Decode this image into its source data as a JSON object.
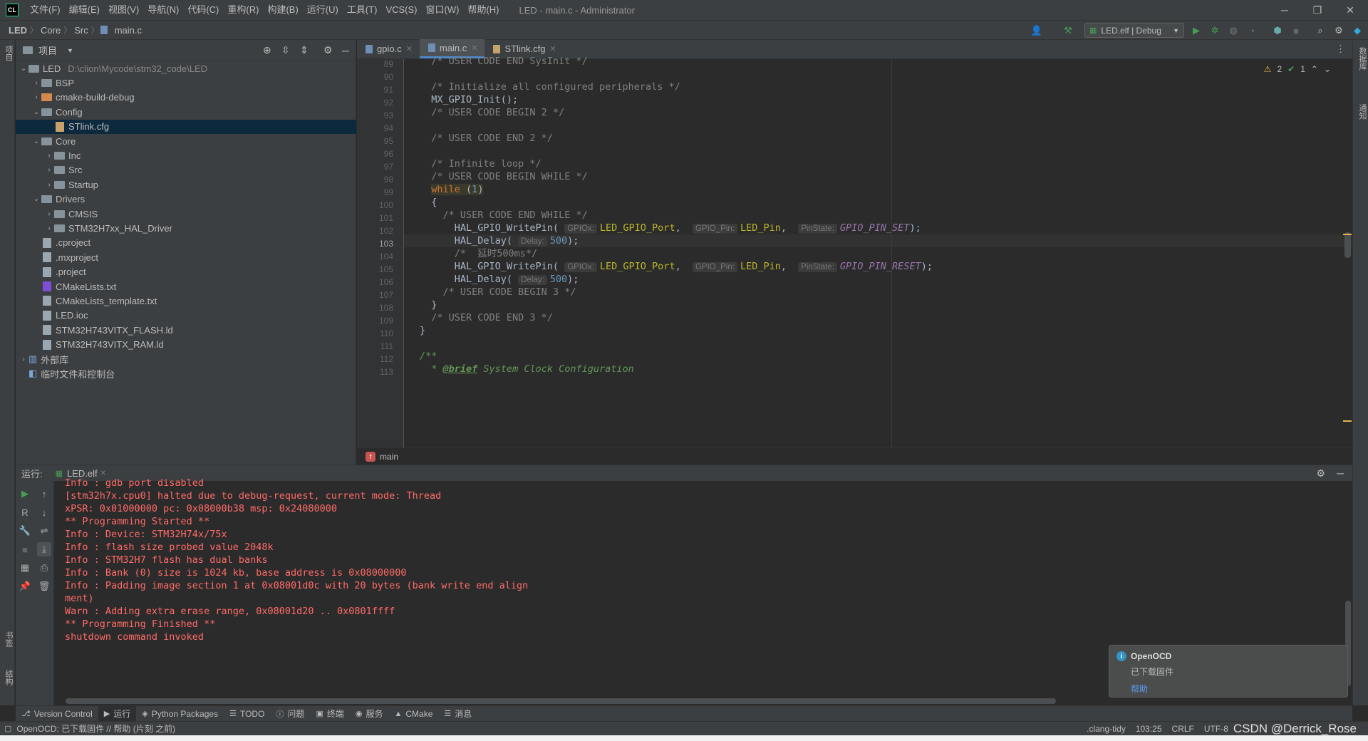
{
  "window": {
    "app_logo": "CL",
    "title": "LED - main.c - Administrator",
    "menu": [
      "文件(F)",
      "编辑(E)",
      "视图(V)",
      "导航(N)",
      "代码(C)",
      "重构(R)",
      "构建(B)",
      "运行(U)",
      "工具(T)",
      "VCS(S)",
      "窗口(W)",
      "帮助(H)"
    ],
    "controls": {
      "minimize": "─",
      "restore": "❐",
      "close": "✕"
    }
  },
  "navbar": {
    "crumbs": [
      "LED",
      "Core",
      "Src",
      "main.c"
    ],
    "run_config": "LED.elf | Debug"
  },
  "left_strip": {
    "labels": [
      "项目",
      "书签",
      "结构"
    ]
  },
  "right_strip": {
    "labels": [
      "数据库",
      "通知"
    ]
  },
  "project": {
    "title": "项目",
    "tree": [
      {
        "label": "LED",
        "hint": "D:\\clion\\Mycode\\stm32_code\\LED",
        "depth": 0,
        "expanded": true,
        "kind": "folder"
      },
      {
        "label": "BSP",
        "depth": 1,
        "expanded": false,
        "kind": "folder"
      },
      {
        "label": "cmake-build-debug",
        "depth": 1,
        "expanded": false,
        "kind": "folder-orange"
      },
      {
        "label": "Config",
        "depth": 1,
        "expanded": true,
        "kind": "folder"
      },
      {
        "label": "STlink.cfg",
        "depth": 2,
        "kind": "cfg",
        "selected": true
      },
      {
        "label": "Core",
        "depth": 1,
        "expanded": true,
        "kind": "folder"
      },
      {
        "label": "Inc",
        "depth": 2,
        "expanded": false,
        "kind": "folder"
      },
      {
        "label": "Src",
        "depth": 2,
        "expanded": false,
        "kind": "folder"
      },
      {
        "label": "Startup",
        "depth": 2,
        "expanded": false,
        "kind": "folder"
      },
      {
        "label": "Drivers",
        "depth": 1,
        "expanded": true,
        "kind": "folder"
      },
      {
        "label": "CMSIS",
        "depth": 2,
        "expanded": false,
        "kind": "folder"
      },
      {
        "label": "STM32H7xx_HAL_Driver",
        "depth": 2,
        "expanded": false,
        "kind": "folder"
      },
      {
        "label": ".cproject",
        "depth": 1,
        "kind": "file"
      },
      {
        "label": ".mxproject",
        "depth": 1,
        "kind": "file"
      },
      {
        "label": ".project",
        "depth": 1,
        "kind": "file"
      },
      {
        "label": "CMakeLists.txt",
        "depth": 1,
        "kind": "cmake"
      },
      {
        "label": "CMakeLists_template.txt",
        "depth": 1,
        "kind": "file"
      },
      {
        "label": "LED.ioc",
        "depth": 1,
        "kind": "file"
      },
      {
        "label": "STM32H743VITX_FLASH.ld",
        "depth": 1,
        "kind": "file"
      },
      {
        "label": "STM32H743VITX_RAM.ld",
        "depth": 1,
        "kind": "file"
      },
      {
        "label": "外部库",
        "depth": 0,
        "expanded": false,
        "kind": "lib"
      },
      {
        "label": "临时文件和控制台",
        "depth": 0,
        "kind": "scratch"
      }
    ]
  },
  "editor": {
    "tabs": [
      {
        "label": "gpio.c",
        "active": false
      },
      {
        "label": "main.c",
        "active": true
      },
      {
        "label": "STlink.cfg",
        "active": false
      }
    ],
    "inspections": {
      "warnings": "2",
      "ok": "1"
    },
    "current_line": "103",
    "lines": [
      {
        "n": "89",
        "html": "<span class='cmt'>  /* USER CODE END SysInit */</span>"
      },
      {
        "n": "90",
        "html": ""
      },
      {
        "n": "91",
        "html": "<span class='cmt'>  /* Initialize all configured peripherals */</span>"
      },
      {
        "n": "92",
        "html": "  MX_GPIO_Init();"
      },
      {
        "n": "93",
        "html": "<span class='cmt'>  /* USER CODE BEGIN 2 */</span>"
      },
      {
        "n": "94",
        "html": ""
      },
      {
        "n": "95",
        "html": "<span class='cmt'>  /* USER CODE END 2 */</span>"
      },
      {
        "n": "96",
        "html": ""
      },
      {
        "n": "97",
        "html": "<span class='cmt'>  /* Infinite loop */</span>"
      },
      {
        "n": "98",
        "html": "<span class='cmt'>  /* USER CODE BEGIN WHILE */</span>"
      },
      {
        "n": "99",
        "html": "  <span style='background:#3b3a2a'><span class='kw'>while</span> (<span class='num'>1</span>)</span>"
      },
      {
        "n": "100",
        "html": "  {"
      },
      {
        "n": "101",
        "html": "<span class='cmt'>    /* USER CODE END WHILE */</span>"
      },
      {
        "n": "102",
        "html": "      HAL_GPIO_WritePin( <span class='hint'>GPIOx:</span><span class='param'>LED_GPIO_Port</span>,  <span class='hint'>GPIO_Pin:</span><span class='param'>LED_Pin</span>,  <span class='hint'>PinState:</span><span class='ital'>GPIO_PIN_SET</span>);"
      },
      {
        "n": "103",
        "html": "      HAL_Delay( <span class='hint'>Delay:</span><span class='num'>500</span>);"
      },
      {
        "n": "104",
        "html": "<span class='cmt'>      /*  延时500ms*/</span>"
      },
      {
        "n": "105",
        "html": "      HAL_GPIO_WritePin( <span class='hint'>GPIOx:</span><span class='param'>LED_GPIO_Port</span>,  <span class='hint'>GPIO_Pin:</span><span class='param'>LED_Pin</span>,  <span class='hint'>PinState:</span><span class='ital'>GPIO_PIN_RESET</span>);"
      },
      {
        "n": "106",
        "html": "      HAL_Delay( <span class='hint'>Delay:</span><span class='num'>500</span>);"
      },
      {
        "n": "107",
        "html": "<span class='cmt'>    /* USER CODE BEGIN 3 */</span>"
      },
      {
        "n": "108",
        "html": "  }"
      },
      {
        "n": "109",
        "html": "<span class='cmt'>  /* USER CODE END 3 */</span>"
      },
      {
        "n": "110",
        "html": "}"
      },
      {
        "n": "111",
        "html": ""
      },
      {
        "n": "112",
        "html": "<span class='doctag'>/**</span>"
      },
      {
        "n": "113",
        "html": "<span class='doctag'>  * <u style='font-weight:bold'>@brief</u> System Clock Configuration</span>"
      }
    ],
    "breadcrumb_fn": "main"
  },
  "run_panel": {
    "label": "运行:",
    "tab": "LED.elf",
    "console": [
      "Info : gdb port disabled",
      "[stm32h7x.cpu0] halted due to debug-request, current mode: Thread",
      "xPSR: 0x01000000 pc: 0x08000b38 msp: 0x24080000",
      "** Programming Started **",
      "Info : Device: STM32H74x/75x",
      "Info : flash size probed value 2048k",
      "Info : STM32H7 flash has dual banks",
      "Info : Bank (0) size is 1024 kb, base address is 0x08000000",
      "Info : Padding image section 1 at 0x08001d0c with 20 bytes (bank write end align",
      "ment)",
      "Warn : Adding extra erase range, 0x08001d20 .. 0x0801ffff",
      "** Programming Finished **",
      "shutdown command invoked"
    ]
  },
  "notification": {
    "title": "OpenOCD",
    "message": "已下载固件",
    "link": "帮助"
  },
  "bottom_tools": [
    {
      "label": "Version Control",
      "icon": "⎇",
      "active": false
    },
    {
      "label": "运行",
      "icon": "▶",
      "active": true
    },
    {
      "label": "Python Packages",
      "icon": "◈",
      "active": false
    },
    {
      "label": "TODO",
      "icon": "☰",
      "active": false
    },
    {
      "label": "问题",
      "icon": "ⓘ",
      "active": false
    },
    {
      "label": "终端",
      "icon": "▣",
      "active": false
    },
    {
      "label": "服务",
      "icon": "◉",
      "active": false
    },
    {
      "label": "CMake",
      "icon": "▲",
      "active": false
    },
    {
      "label": "消息",
      "icon": "☰",
      "active": false
    }
  ],
  "statusbar": {
    "message": "OpenOCD: 已下载固件 // 帮助 (片刻 之前)",
    "items": [
      ".clang-tidy",
      "103:25",
      "CRLF",
      "UTF-8"
    ],
    "watermark": "CSDN @Derrick_Rose"
  },
  "colors": {
    "accent": "#4a88c7",
    "console_error": "#ff6b68",
    "run_green": "#499c54"
  }
}
